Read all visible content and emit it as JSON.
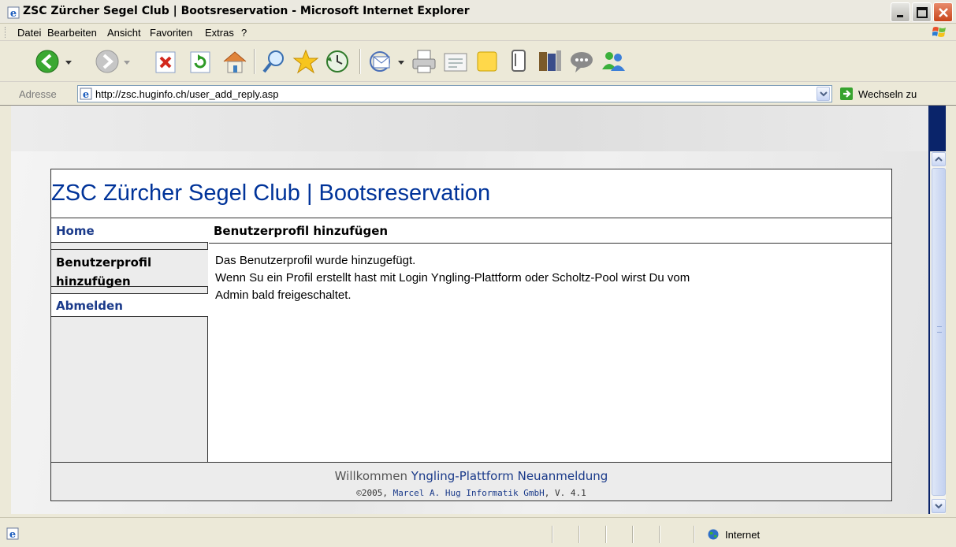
{
  "window": {
    "title": "ZSC Zürcher Segel Club | Bootsreservation - Microsoft Internet Explorer"
  },
  "menu": {
    "items": [
      "Datei",
      "Bearbeiten",
      "Ansicht",
      "Favoriten",
      "Extras",
      "?"
    ]
  },
  "toolbar": {
    "icons": [
      "back-icon",
      "forward-icon",
      "stop-icon",
      "refresh-icon",
      "home-icon",
      "search-icon",
      "favorites-icon",
      "history-icon",
      "mail-icon",
      "print-icon",
      "edit-icon",
      "discuss-icon",
      "messenger-icon",
      "research-icon",
      "chat-icon",
      "contacts-icon"
    ]
  },
  "address": {
    "label": "Adresse",
    "url": "http://zsc.huginfo.ch/user_add_reply.asp",
    "go_label": "Wechseln zu"
  },
  "page": {
    "site_title": "ZSC Zürcher Segel Club | Bootsreservation",
    "nav": {
      "home": "Home",
      "current_line1": "Benutzerprofil",
      "current_line2": "hinzufügen",
      "logout": "Abmelden"
    },
    "content": {
      "heading": "Benutzerprofil hinzufügen",
      "line1": "Das Benutzerprofil wurde hinzugefügt.",
      "line2": "Wenn Su ein Profil erstellt hast mit Login Yngling-Plattform oder Scholtz-Pool wirst Du vom",
      "line3": "Admin bald freigeschaltet."
    },
    "footer": {
      "welcome": "Willkommen",
      "user": "Yngling-Plattform Neuanmeldung",
      "copyright": "©2005,",
      "company": "Marcel A. Hug Informatik GmbH",
      "version": ", V. 4.1"
    }
  },
  "status": {
    "zone": "Internet"
  },
  "colors": {
    "site_title": "#003399",
    "nav_link": "#1a3a8a",
    "chrome": "#ece9d8"
  }
}
